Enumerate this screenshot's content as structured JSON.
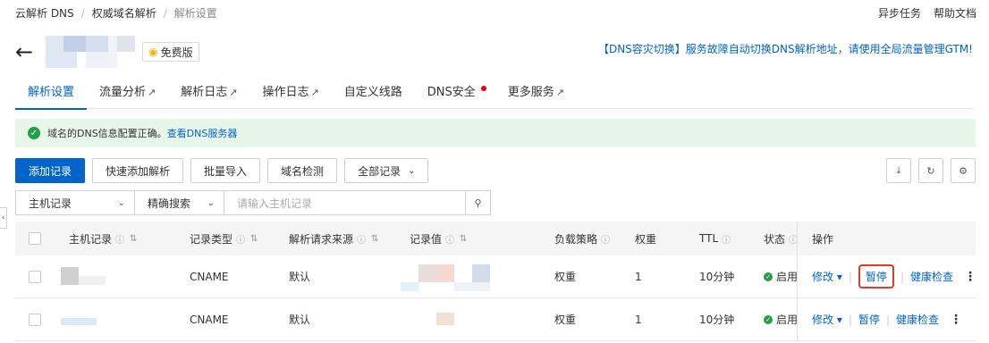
{
  "breadcrumb": [
    "云解析 DNS",
    "权威域名解析",
    "解析设置"
  ],
  "top_links": [
    "异步任务",
    "帮助文档"
  ],
  "header": {
    "badge": "免费版"
  },
  "notice": "【DNS容灾切换】服务故障自动切换DNS解析地址，请使用全局流量管理GTM!",
  "tabs": [
    {
      "label": "解析设置",
      "active": true,
      "external": false
    },
    {
      "label": "流量分析",
      "external": true
    },
    {
      "label": "解析日志",
      "external": true
    },
    {
      "label": "操作日志",
      "external": true
    },
    {
      "label": "自定义线路",
      "external": false
    },
    {
      "label": "DNS安全",
      "external": false,
      "dot": true
    },
    {
      "label": "更多服务",
      "external": true
    }
  ],
  "alert": {
    "text": "域名的DNS信息配置正确。",
    "link": "查看DNS服务器"
  },
  "toolbar": {
    "add": "添加记录",
    "quick_add": "快速添加解析",
    "batch_import": "批量导入",
    "check": "域名检测",
    "filter": "全部记录"
  },
  "filters": {
    "type": "主机记录",
    "mode": "精确搜索",
    "placeholder": "请输入主机记录"
  },
  "columns": {
    "host": "主机记录",
    "type": "记录类型",
    "source": "解析请求来源",
    "value": "记录值",
    "strategy": "负载策略",
    "weight": "权重",
    "ttl": "TTL",
    "status": "状态",
    "ops": "操作"
  },
  "rows": [
    {
      "type": "CNAME",
      "source": "默认",
      "strategy": "权重",
      "weight": "1",
      "ttl": "10分钟",
      "status": "启用"
    },
    {
      "type": "CNAME",
      "source": "默认",
      "strategy": "权重",
      "weight": "1",
      "ttl": "10分钟",
      "status": "启用"
    }
  ],
  "ops": {
    "edit": "修改",
    "pause": "暂停",
    "health": "健康检查"
  },
  "colors": {
    "accent": "#0064c8",
    "success": "#23a047",
    "highlight": "#e23a24",
    "alert_bg": "#e8f6e9"
  }
}
